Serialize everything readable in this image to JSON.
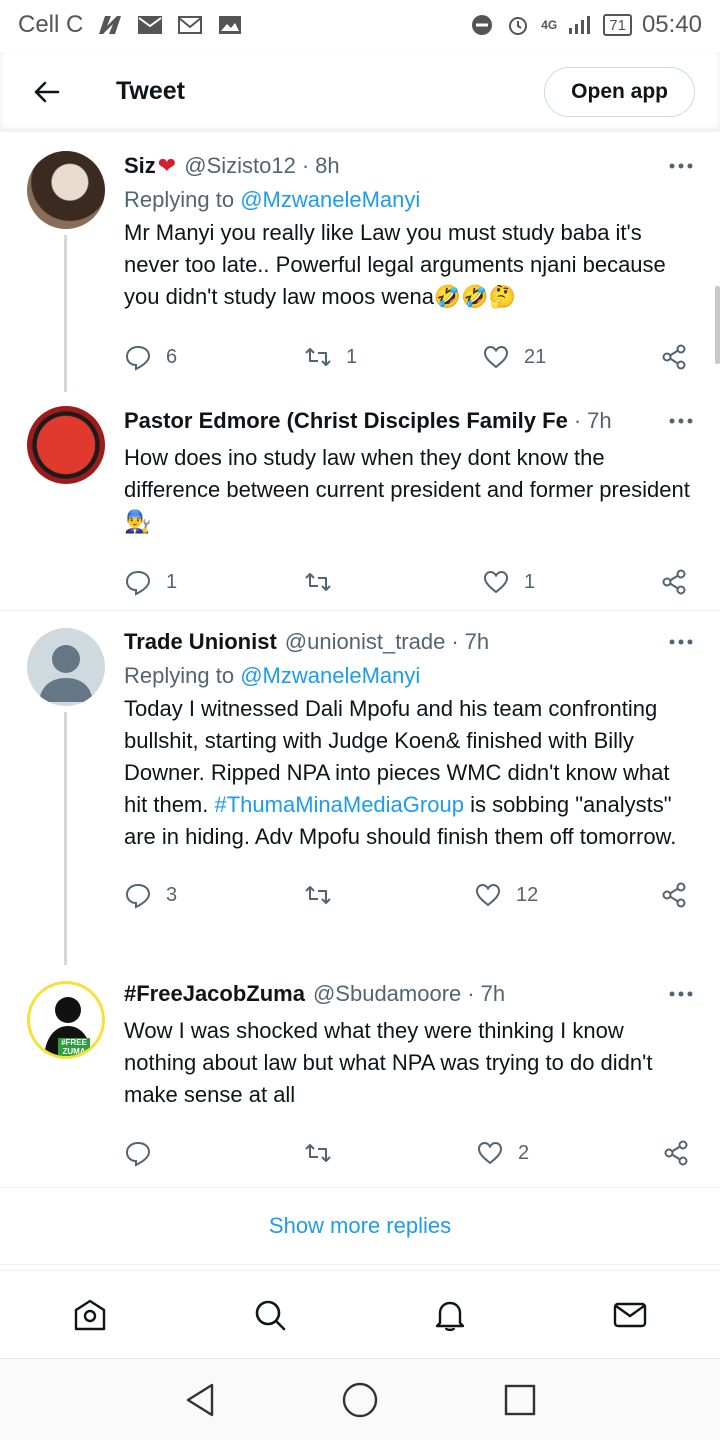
{
  "status_bar": {
    "carrier": "Cell C",
    "network": "4G",
    "battery": "71",
    "time": "05:40"
  },
  "header": {
    "title": "Tweet",
    "open_app_label": "Open app"
  },
  "tweets": [
    {
      "name": "Siz",
      "name_emoji": "❤",
      "handle": "@Sizisto12",
      "time": "8h",
      "replying_prefix": "Replying to ",
      "replying_to": "@MzwaneleManyi",
      "body": "Mr Manyi you really like Law you must study baba it's never too late.. Powerful legal arguments njani because you didn't study law moos wena🤣🤣🤔",
      "replies": "6",
      "retweets": "1",
      "likes": "21"
    },
    {
      "name": "Pastor Edmore (Christ Disciples Family Fe",
      "handle": "",
      "time": "7h",
      "body": "How does ino study law when they dont know the difference between current president and former president👨‍🔧",
      "replies": "1",
      "retweets": "",
      "likes": "1"
    },
    {
      "name": "Trade Unionist",
      "handle": "@unionist_trade",
      "time": "7h",
      "replying_prefix": "Replying to ",
      "replying_to": "@MzwaneleManyi",
      "body_before": "Today I witnessed Dali Mpofu and his team confronting bullshit, starting with Judge Koen& finished with Billy Downer. Ripped NPA into pieces WMC didn't know what hit them. ",
      "hashtag": "#ThumaMinaMediaGroup",
      "body_after": " is sobbing \"analysts\" are in hiding. Adv Mpofu should finish them off tomorrow.",
      "replies": "3",
      "retweets": "",
      "likes": "12"
    },
    {
      "name": "#FreeJacobZuma",
      "handle": "@Sbudamoore",
      "time": "7h",
      "avatar_text": "#FREE ZUMA",
      "body": "Wow I was shocked what they were thinking I know nothing about law but what NPA was trying to do didn't make sense at all",
      "replies": "",
      "retweets": "",
      "likes": "2"
    }
  ],
  "show_more": "Show more replies",
  "icons": {
    "reply": "reply-icon",
    "retweet": "retweet-icon",
    "like": "heart-icon",
    "share": "share-icon",
    "more": "more-icon"
  },
  "colors": {
    "accent": "#1d9bf0",
    "secondary_text": "#536471",
    "divider": "#eff3f4"
  }
}
